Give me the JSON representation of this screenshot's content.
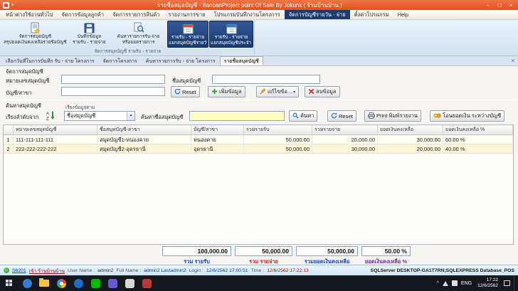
{
  "window": {
    "title": "รายชื่อสมุดบัญชี - BanbanProject point Of Sale By Jokunk ( ร้านบ้านบ้าน )"
  },
  "icons": {
    "minimize": "–",
    "maximize": "□",
    "close": "×",
    "dropdown": "▾",
    "tab_close": "×",
    "tray_chevron": "^"
  },
  "menu_tabs": [
    {
      "label": "หน้าต่างใช้งานทั่วไป"
    },
    {
      "label": "จัดการข้อมูลลูกค้า"
    },
    {
      "label": "จัดการรายการสินค้า"
    },
    {
      "label": "รายงานการขาย"
    },
    {
      "label": "โปรแกรมบันทึกงานโครงการ"
    },
    {
      "label": "จัดการบัญชีรายวัน - จ่าย"
    },
    {
      "label": "ตั้งค่าโปรแกรม"
    },
    {
      "label": "Help"
    }
  ],
  "ribbon": {
    "buttons": [
      {
        "line1": "จัดการสมุดบัญชี",
        "line2": "สรุปยอดเงินคงเหลือรายชื่อบัญชี"
      },
      {
        "line1": "บันทึกข้อมูล",
        "line2": "รายรับ - รายจ่าย"
      },
      {
        "line1": "ค้นหารายการรับ-จ่าย",
        "line2": "หรือยอดรายการ"
      },
      {
        "line1": "รายรับ - รายจ่าย",
        "line2": "แยกสมุดบัญชีรายวันที่"
      },
      {
        "line1": "รายรับ - รายจ่าย",
        "line2": "แยกสมุดบัญชีประจำ เดือน / ปี"
      }
    ],
    "group_caption": "จัดการสมุดบัญชี รายรับ - รายจ่าย"
  },
  "doc_tabs": [
    {
      "label": "เลือกวันที่ในการบันทึก รับ - จ่าย โครงการ"
    },
    {
      "label": "จัดการโครงการ"
    },
    {
      "label": "ค้นหารายการรับ - จ่าย โครงการ"
    },
    {
      "label": "รายชื่อสมุดบัญชี"
    }
  ],
  "form": {
    "section_title": "จัดการสมุดบัญชี",
    "account_no_label": "หมายเลขสมุดบัญชี",
    "account_no_value": "",
    "account_name_label": "ชื่อสมุดบัญชี",
    "account_name_value": "",
    "branch_label": "บัญชี/สาขา",
    "branch_value": "",
    "reset_label": "Reset",
    "add_label": "เพิ่มข้อมูล",
    "edit_label": "แก้ไขข้อ...",
    "delete_label": "ลบข้อมูล"
  },
  "search": {
    "section_title": "ค้นหาสมุดบัญชี",
    "sort_from_label": "เรียงลำดับจาก",
    "sort_by_label": "เรียงข้อมูลตาม",
    "sort_by_value": "ชื่อสมุดบัญชี",
    "find_label": "ค้นหาชื่อสมุดบัญชี",
    "find_value": "",
    "search_btn": "ค้นหา",
    "reset_btn": "Reset",
    "print_btn": "Print พิมพ์รายงาน",
    "transfer_btn": "โอนยอดเงิน ระหว่างบัญชี"
  },
  "grid": {
    "columns": [
      "หมายเลขสมุดบัญชี",
      "ชื่อสมุดบัญชี-สาขา",
      "บัญชี/สาขา",
      "รวมรายรับ",
      "รวมรายจ่าย",
      "ยอดเงินคงเหลือ",
      "ยอดเงินคงเหลือ %"
    ],
    "rows": [
      {
        "num": "1",
        "account_no": "111-111-111-111",
        "name": "สมุดบัญชี1-หนองคาย",
        "branch": "หนองคาย",
        "income": "50,000.00",
        "expense": "20,000.00",
        "balance": "30,000.00",
        "percent": "60.00 %"
      },
      {
        "num": "2",
        "account_no": "222-222-222-222",
        "name": "สมุดบัญชี2-อุดรธานี",
        "branch": "อุดรธานี",
        "income": "50,000.00",
        "expense": "30,000.00",
        "balance": "20,000.00",
        "percent": "40.00 %"
      }
    ]
  },
  "summary": {
    "income_value": "100,000.00",
    "income_label": "รวม รายรับ",
    "expense_value": "50,000.00",
    "expense_label": "รวม รายจ่าย",
    "balance_value": "50,000.00",
    "balance_label": "รวมยอดเงินคงเหลือ",
    "percent_value": "50.00 %",
    "percent_label": "ยอดเงินคงเหลือ %"
  },
  "statusbar": {
    "code_link": "S6201",
    "shop_link": "เข้า ร้านบ้านบ้าน",
    "user_name_label": "User Name :",
    "user_name": "admin2",
    "full_name_label": "Full Name :",
    "full_name": "admin2 Lastadmin2",
    "login_label": "Login :",
    "login_value": "12/6/2562 17:00:51",
    "time_label": "Time :",
    "time_value": "12/6/2562 17:22:13",
    "server_info": "SQLServer DESKTOP-GA1T7RN;SQLEXPRESS  Database_POS"
  },
  "taskbar": {
    "lang": "ENG",
    "time": "17:22",
    "date": "12/6/2562"
  },
  "colors": {
    "titlebar": "#e85c30",
    "active_tab": "#1d3c6e",
    "ribbon_bg": "#dce6f2",
    "search_field_bg": "#ffffc2",
    "income_label": "#1546c8",
    "expense_label": "#d42020",
    "balance_label": "#1546c8",
    "percent_label": "#7030a0",
    "row_highlight": "#fcf6d8"
  }
}
